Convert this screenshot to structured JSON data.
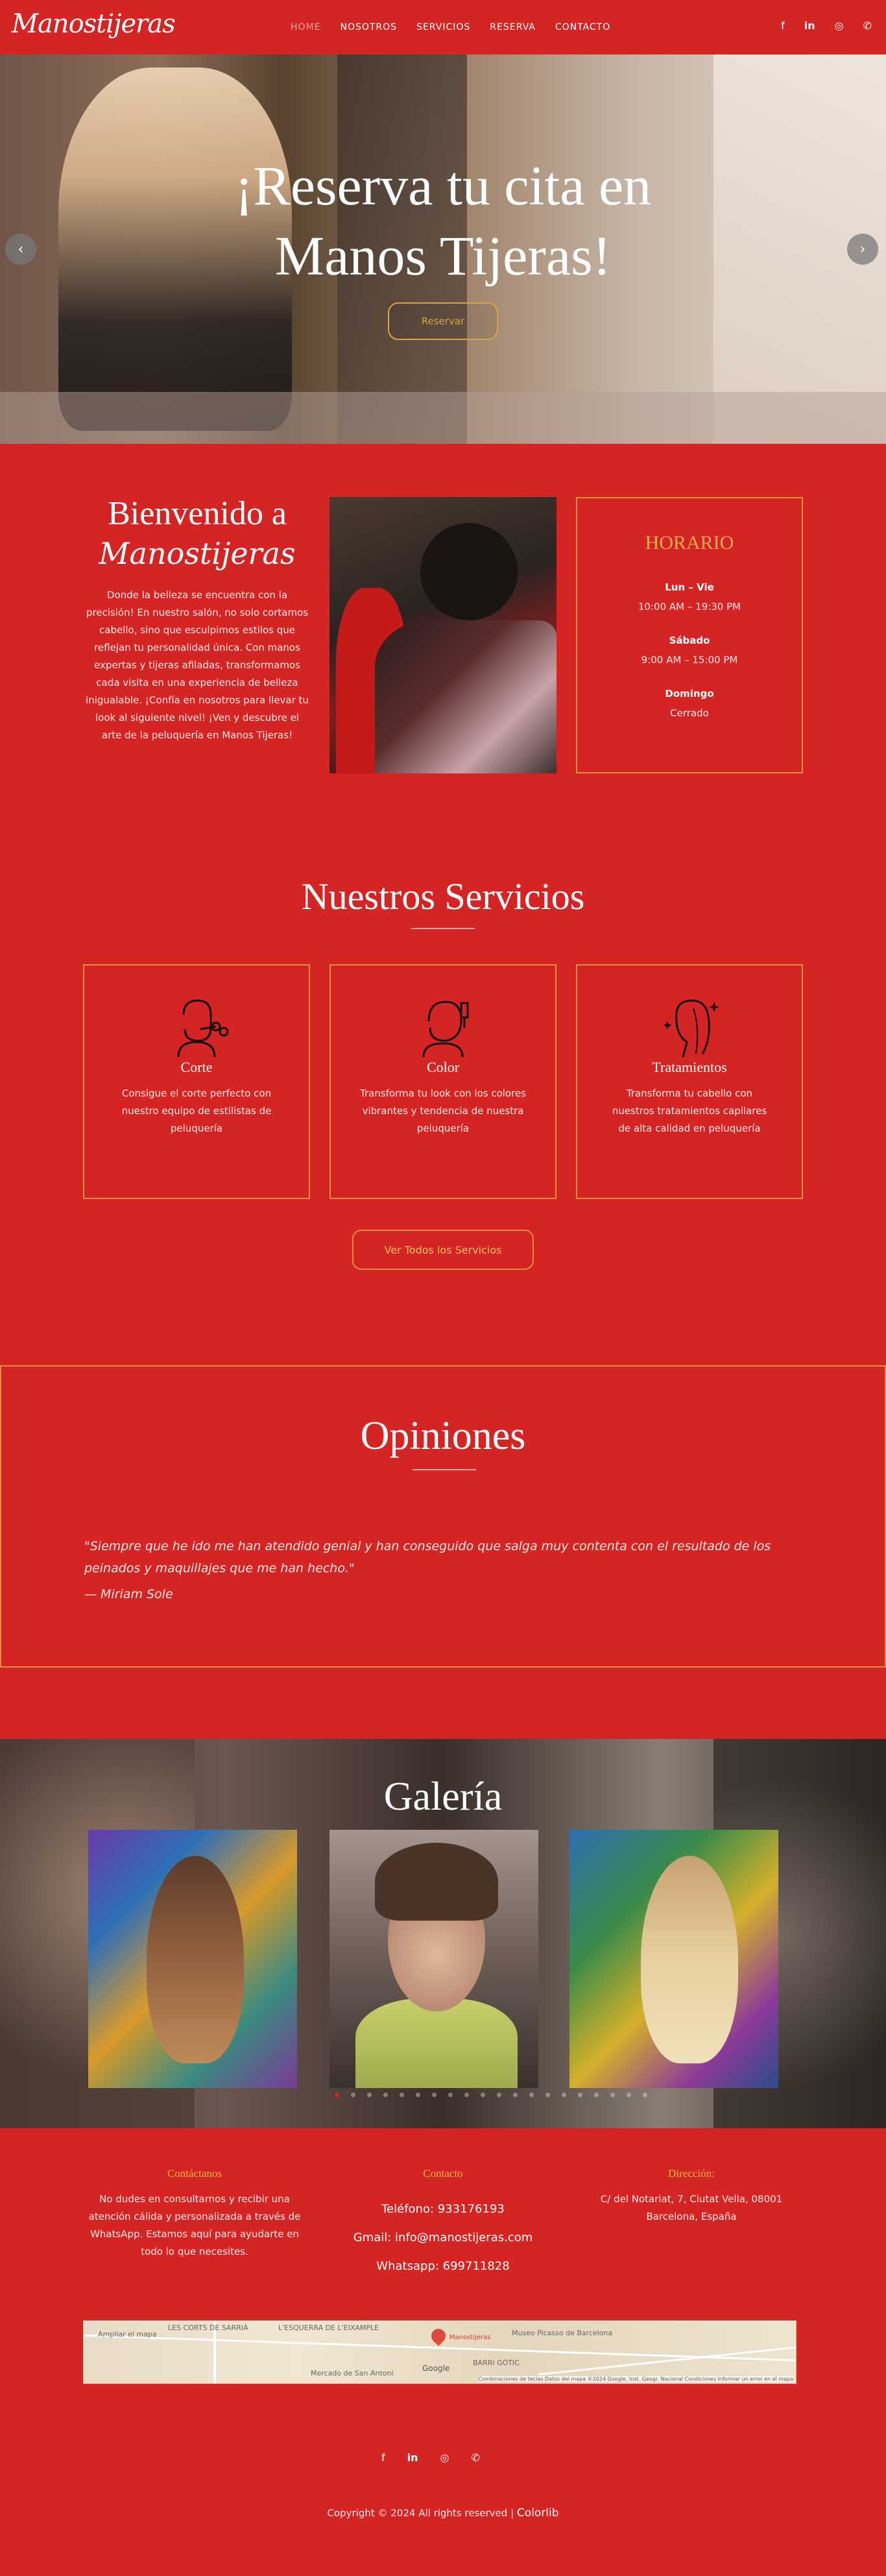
{
  "header": {
    "logo": "Manostijeras",
    "nav": [
      "HOME",
      "NOSOTROS",
      "SERVICIOS",
      "RESERVA",
      "CONTACTO"
    ],
    "social_icons": [
      "facebook-icon",
      "linkedin-icon",
      "instagram-icon",
      "whatsapp-icon"
    ]
  },
  "hero": {
    "title_line1": "¡Reserva tu cita en",
    "title_line2": "Manos Tijeras!",
    "button": "Reservar"
  },
  "welcome": {
    "title": "Bienvenido a",
    "signature": "Manostijeras",
    "text": "Donde la belleza se encuentra con la precisión! En nuestro salón, no solo cortamos cabello, sino que esculpimos estilos que reflejan tu personalidad única. Con manos expertas y tijeras afiladas, transformamos cada visita en una experiencia de belleza inigualable. ¡Confía en nosotros para llevar tu look al siguiente nivel! ¡Ven y descubre el arte de la peluquería en Manos Tijeras!"
  },
  "hours": {
    "title": "HORARIO",
    "rows": [
      {
        "day": "Lun – Vie",
        "time": "10:00 AM – 19:30 PM"
      },
      {
        "day": "Sábado",
        "time": "9:00 AM – 15:00 PM"
      },
      {
        "day": "Domingo",
        "time": "Cerrado"
      }
    ]
  },
  "services": {
    "title": "Nuestros Servicios",
    "items": [
      {
        "name": "Corte",
        "text": "Consigue el corte perfecto con nuestro equipo de estilistas de peluquería",
        "icon": "haircut-icon"
      },
      {
        "name": "Color",
        "text": "Transforma tu look con los colores vibrantes y tendencia de nuestra peluquería",
        "icon": "hair-color-icon"
      },
      {
        "name": "Tratamientos",
        "text": "Transforma tu cabello con nuestros tratamientos capilares de alta calidad en peluquería",
        "icon": "hair-treatment-icon"
      }
    ],
    "button": "Ver Todos los Servicios"
  },
  "opinions": {
    "title": "Opiniones",
    "quote": "\"Siempre que he ido me han atendido genial y han conseguido que salga muy contenta con el resultado de los peinados y maquillajes que me han hecho.\"",
    "author": "— Miriam Sole"
  },
  "gallery": {
    "title": "Galería"
  },
  "contact": {
    "col1_title": "Contáctanos",
    "col1_text": "No dudes en consultarnos y recibir una atención cálida y personalizada a través de WhatsApp. Estamos aquí para ayudarte en todo lo que necesites.",
    "col2_title": "Contacto",
    "phone_label": "Teléfono:",
    "phone": "933176193",
    "email_label": "Gmail:",
    "email": "info@manostijeras.com",
    "whatsapp_label": "Whatsapp:",
    "whatsapp": "699711828",
    "col3_title": "Dirección:",
    "address": "C/ del Notariat, 7, Ciutat Vella, 08001 Barcelona, España"
  },
  "map": {
    "labels": [
      "Ampliar el mapa",
      "LES CORTS DE SARRIÀ",
      "L'ESQUERRA DE L'EIXAMPLE",
      "Manostijeras",
      "Museo Picasso de Barcelona",
      "BARRI GÒTIC",
      "Mercado de San Antoni",
      "Google"
    ],
    "attribution": "Combinaciones de teclas  Datos del mapa ©2024 Google, Inst. Geogr. Nacional  Condiciones  Informar un error en el mapa"
  },
  "footer": {
    "social_icons": [
      "facebook-icon",
      "linkedin-icon",
      "instagram-icon",
      "whatsapp-icon"
    ],
    "copyright": "Copyright © 2024 All rights reserved |",
    "brand": "Colorlib"
  }
}
